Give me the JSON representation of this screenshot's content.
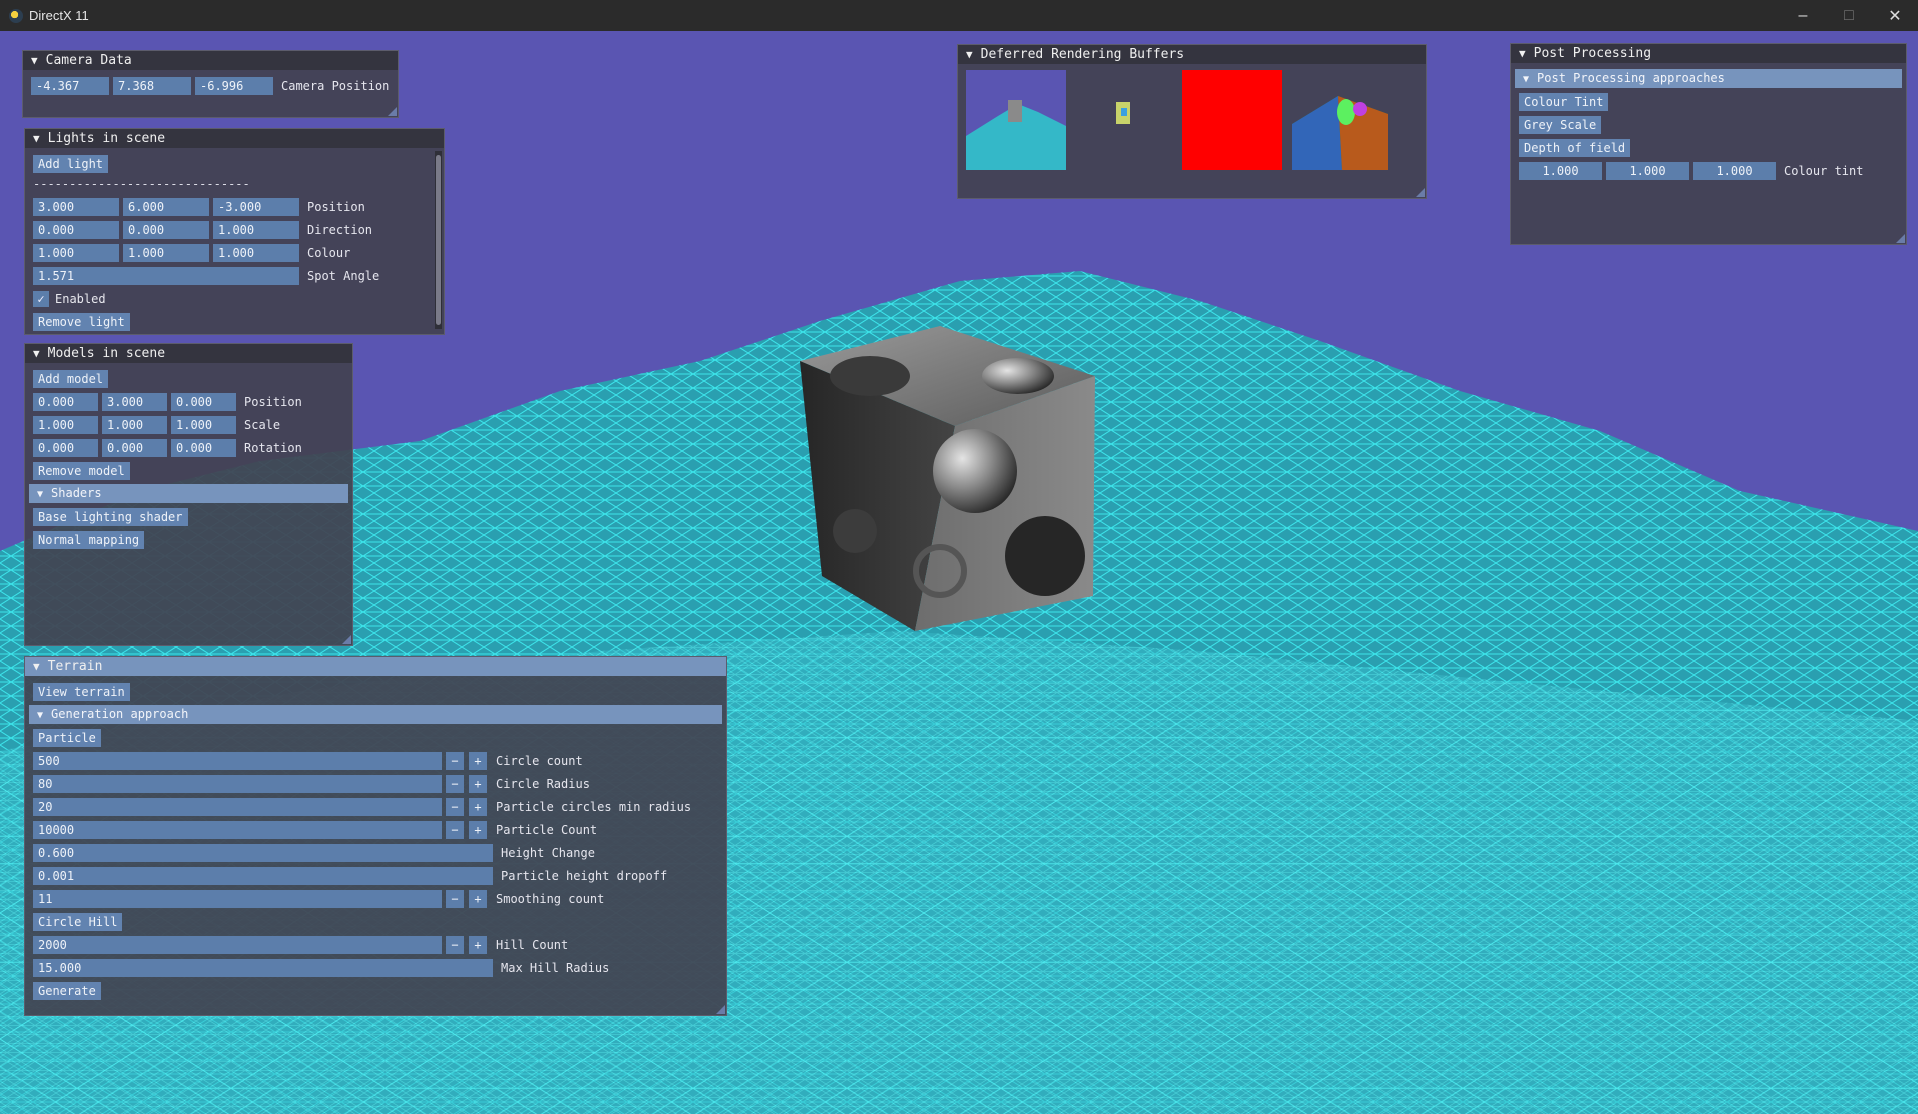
{
  "window": {
    "title": "DirectX 11"
  },
  "colors": {
    "sky": "#5a55b2",
    "terrain_wire": "#27e0e6",
    "panel_bg": "#42424f",
    "field": "#5c7eab",
    "header": "#7794bd"
  },
  "camera_panel": {
    "title": "Camera Data",
    "position": [
      "-4.367",
      "7.368",
      "-6.996"
    ],
    "position_label": "Camera Position"
  },
  "lights_panel": {
    "title": "Lights in scene",
    "add_label": "Add light",
    "separator": "------------------------------",
    "position": [
      "3.000",
      "6.000",
      "-3.000"
    ],
    "position_label": "Position",
    "direction": [
      "0.000",
      "0.000",
      "1.000"
    ],
    "direction_label": "Direction",
    "colour": [
      "1.000",
      "1.000",
      "1.000"
    ],
    "colour_label": "Colour",
    "spot_angle": "1.571",
    "spot_angle_label": "Spot Angle",
    "enabled_label": "Enabled",
    "remove_label": "Remove light"
  },
  "models_panel": {
    "title": "Models in scene",
    "add_label": "Add model",
    "position": [
      "0.000",
      "3.000",
      "0.000"
    ],
    "position_label": "Position",
    "scale": [
      "1.000",
      "1.000",
      "1.000"
    ],
    "scale_label": "Scale",
    "rotation": [
      "0.000",
      "0.000",
      "0.000"
    ],
    "rotation_label": "Rotation",
    "remove_label": "Remove model",
    "shaders_header": "Shaders",
    "shader_buttons": [
      "Base lighting shader",
      "Normal mapping"
    ]
  },
  "terrain_panel": {
    "title": "Terrain",
    "view_label": "View terrain",
    "generation_header": "Generation approach",
    "particle_label": "Particle",
    "circle_count": "500",
    "circle_count_label": "Circle count",
    "circle_radius": "80",
    "circle_radius_label": "Circle Radius",
    "min_radius": "20",
    "min_radius_label": "Particle circles min radius",
    "particle_count": "10000",
    "particle_count_label": "Particle Count",
    "height_change": "0.600",
    "height_change_label": "Height Change",
    "height_dropoff": "0.001",
    "height_dropoff_label": "Particle height dropoff",
    "smoothing": "11",
    "smoothing_label": "Smoothing count",
    "circle_hill_label": "Circle Hill",
    "hill_count": "2000",
    "hill_count_label": "Hill Count",
    "max_hill_radius": "15.000",
    "max_hill_radius_label": "Max Hill Radius",
    "generate_label": "Generate",
    "minus": "−",
    "plus": "+"
  },
  "deferred_panel": {
    "title": "Deferred Rendering Buffers"
  },
  "post_panel": {
    "title": "Post Processing",
    "approaches_header": "Post Processing approaches",
    "buttons": [
      "Colour Tint",
      "Grey Scale",
      "Depth of field"
    ],
    "tint": [
      "1.000",
      "1.000",
      "1.000"
    ],
    "tint_label": "Colour tint"
  }
}
